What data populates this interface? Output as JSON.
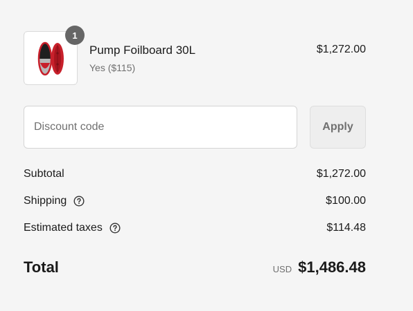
{
  "line_item": {
    "quantity": "1",
    "name": "Pump Foilboard 30L",
    "variant": "Yes ($115)",
    "price": "$1,272.00",
    "image_icon": "foilboard-product-image"
  },
  "discount": {
    "placeholder": "Discount code",
    "value": "",
    "apply_label": "Apply"
  },
  "summary": {
    "subtotal_label": "Subtotal",
    "subtotal_value": "$1,272.00",
    "shipping_label": "Shipping",
    "shipping_value": "$100.00",
    "taxes_label": "Estimated taxes",
    "taxes_value": "$114.48",
    "help_icon": "question-circle-icon"
  },
  "total": {
    "label": "Total",
    "currency": "USD",
    "amount": "$1,486.48"
  },
  "colors": {
    "background": "#f5f5f5",
    "badge": "#666666",
    "board_red": "#c8202b",
    "muted_text": "#707070"
  }
}
